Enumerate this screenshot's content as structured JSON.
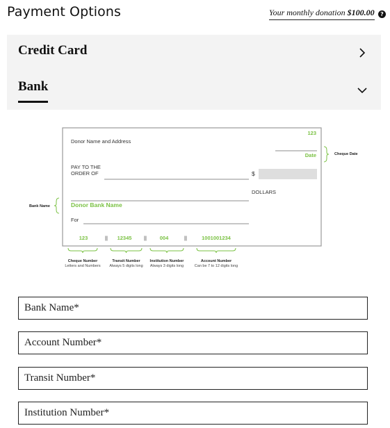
{
  "header": {
    "title": "Payment Options",
    "donation_prefix": "Your monthly donation",
    "donation_amount": "$100.00",
    "help_glyph": "?"
  },
  "accordion": {
    "items": [
      {
        "label": "Credit Card",
        "state": "collapsed",
        "icon": "chevron-right-icon"
      },
      {
        "label": "Bank",
        "state": "active",
        "icon": "chevron-down-icon"
      }
    ]
  },
  "cheque": {
    "cheque_no": "123",
    "date_label": "Date",
    "donor_label": "Donor Name and Address",
    "pay_to_1": "PAY TO THE",
    "pay_to_2": "ORDER OF",
    "dollar_sign": "$",
    "dollars": "DOLLARS",
    "donor_bank": "Donor Bank Name",
    "for_label": "For",
    "micr": [
      "123",
      "||",
      "12345",
      "||",
      "004",
      "||",
      "1001001234"
    ],
    "side_cheque_date": "Cheque Date",
    "side_bank_name": "Bank Name",
    "captions": [
      {
        "title": "Cheque Number",
        "sub": "Letters and Numbers"
      },
      {
        "title": "Transit Number",
        "sub": "Always 5 digits long"
      },
      {
        "title": "Institution Number",
        "sub": "Always 3 digits long"
      },
      {
        "title": "Account Number",
        "sub": "Can be 7 to 12 digits long"
      }
    ],
    "accent_color": "#7ac143"
  },
  "form": {
    "bank_name": "Bank Name*",
    "account_number": "Account Number*",
    "transit_number": "Transit Number*",
    "institution_number": "Institution Number*"
  }
}
